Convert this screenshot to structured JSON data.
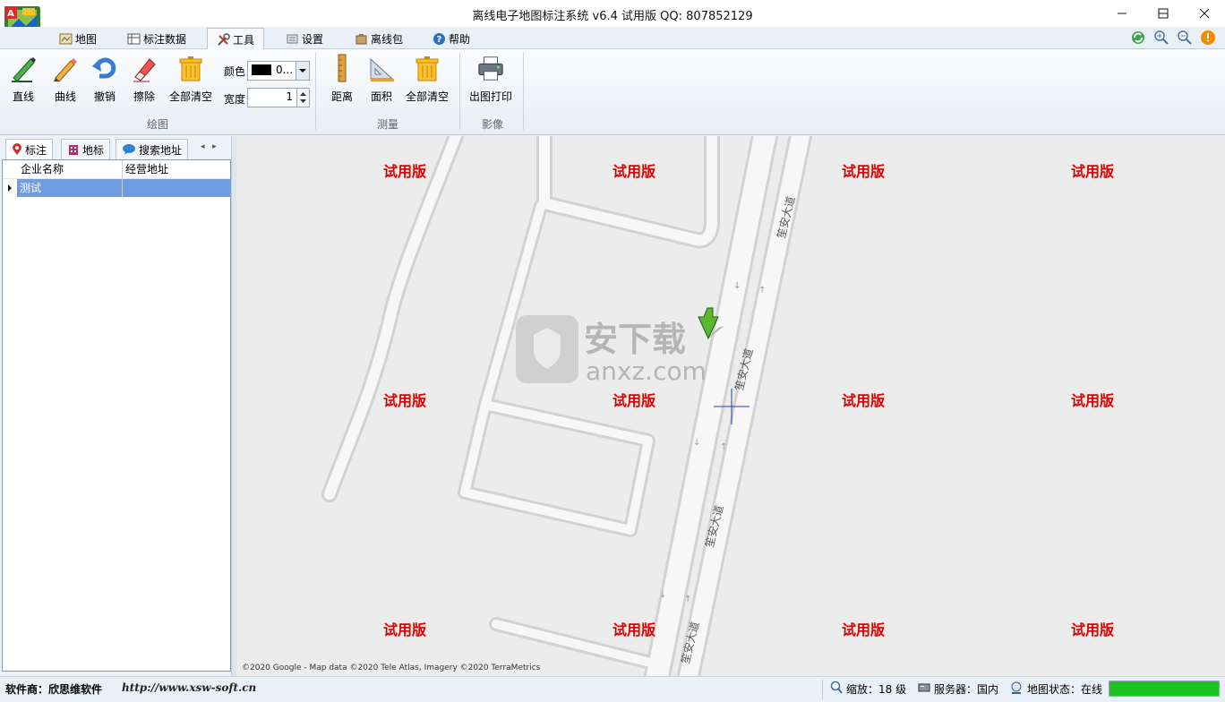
{
  "window": {
    "title": "离线电子地图标注系统 v6.4 试用版 QQ: 807852129"
  },
  "menu": {
    "tabs": [
      {
        "label": "地图"
      },
      {
        "label": "标注数据"
      },
      {
        "label": "工具"
      },
      {
        "label": "设置"
      },
      {
        "label": "离线包"
      },
      {
        "label": "帮助"
      }
    ]
  },
  "ribbon": {
    "draw": {
      "line": "直线",
      "curve": "曲线",
      "undo": "撤销",
      "erase": "擦除",
      "clear_all": "全部清空",
      "group_label": "绘图"
    },
    "color_label": "颜色",
    "color_value": "0...",
    "width_label": "宽度",
    "width_value": "1",
    "measure": {
      "distance": "距离",
      "area": "面积",
      "clear_all": "全部清空",
      "group_label": "测量"
    },
    "image": {
      "print": "出图打印",
      "group_label": "影像"
    }
  },
  "left_panel": {
    "tabs": [
      {
        "label": "标注"
      },
      {
        "label": "地标"
      },
      {
        "label": "搜索地址"
      }
    ],
    "columns": [
      "企业名称",
      "经营地址"
    ],
    "rows": [
      {
        "name": "测试",
        "address": ""
      }
    ]
  },
  "map": {
    "watermark": "试用版",
    "road_label": "笙安大道",
    "overlay_brand": "安下载",
    "overlay_domain": "anxz.com",
    "copyright": "©2020 Google - Map data ©2020 Tele Atlas, Imagery ©2020 TerraMetrics"
  },
  "status": {
    "vendor": "软件商：欣思维软件",
    "url": "http://www.xsw-soft.cn",
    "zoom": "缩放：18 级",
    "server": "服务器：国内",
    "map_state": "地图状态：在线",
    "progress": 1.0
  },
  "colors": {
    "accent": "#1f7ed6",
    "watermark": "#e00000",
    "progress": "#1fc31f",
    "selected_row": "#6f9de0"
  }
}
